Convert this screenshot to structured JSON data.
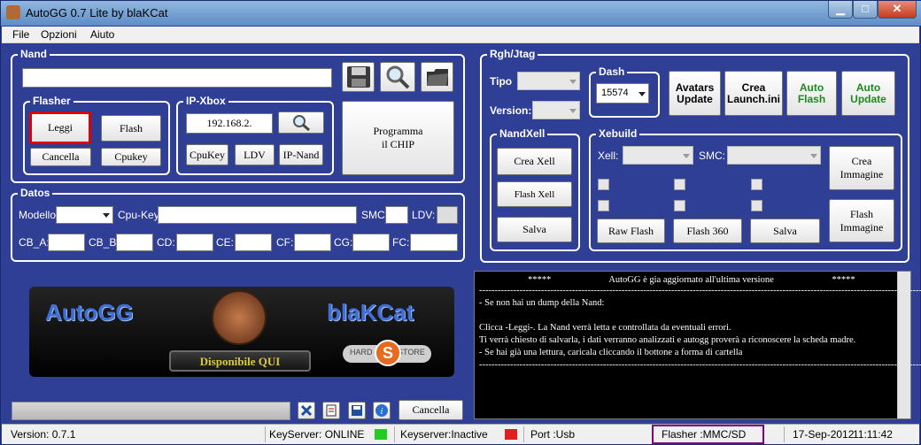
{
  "window": {
    "title": "AutoGG 0.7 Lite by blaKCat"
  },
  "menu": [
    "File",
    "Opzioni",
    "Aiuto"
  ],
  "nand": {
    "title": "Nand",
    "path_value": "",
    "icons": [
      "save-icon",
      "search-icon",
      "folder-icon"
    ]
  },
  "flasher": {
    "title": "Flasher",
    "leggi": "Leggi",
    "flash": "Flash",
    "cancella": "Cancella",
    "cpukey": "Cpukey"
  },
  "ipxbox": {
    "title": "IP-Xbox",
    "ip_value": "192.168.2.",
    "cpukey": "CpuKey",
    "ldv": "LDV",
    "ipnand": "IP-Nand"
  },
  "programma": {
    "label_1": "Programma",
    "label_2": "il CHIP"
  },
  "datos": {
    "title": "Datos",
    "modello": "Modello:",
    "cpukey": "Cpu-Key:",
    "smc": "SMC:",
    "ldv": "LDV:",
    "fields": [
      "CB_A:",
      "CB_B:",
      "CD:",
      "CE:",
      "CF:",
      "CG:",
      "FC:"
    ]
  },
  "rgh": {
    "title": "Rgh/Jtag",
    "tipo": "Tipo",
    "version": "Version:",
    "dash_title": "Dash",
    "dash_value": "15574",
    "avatars": [
      "Avatars",
      "Update"
    ],
    "crea_launch": [
      "Crea",
      "Launch.ini"
    ],
    "auto_flash": [
      "Auto",
      "Flash"
    ],
    "auto_update": [
      "Auto",
      "Update"
    ]
  },
  "nandxell": {
    "title": "NandXell",
    "crea": "Crea Xell",
    "flash": "Flash Xell",
    "salva": "Salva"
  },
  "xebuild": {
    "title": "Xebuild",
    "xell": "Xell:",
    "smc": "SMC:",
    "raw_flash": "Raw Flash",
    "flash360": "Flash 360",
    "salva": "Salva",
    "crea_img": [
      "Crea",
      "Immagine"
    ],
    "flash_img": [
      "Flash",
      "Immagine"
    ]
  },
  "log": {
    "lines": [
      "*****                         AutoGG è gia aggiornato all'ultima versione                         *****",
      "------------------------------------------------------------------------------------------------------------------------------------------------",
      "- Se non hai un dump della Nand:",
      "",
      "Clicca -Leggi-. La Nand verrà letta e controllata da eventuali errori.",
      "Ti verrà chiesto di salvarla, i dati verranno analizzati e autogg proverà a riconoscere la scheda madre.",
      "- Se hai già una lettura, caricala cliccando il bottone a forma di cartella",
      "------------------------------------------------------------------------------------------------------------------------------------------------"
    ]
  },
  "banner": {
    "left": "AutoGG",
    "right": "blaKCat",
    "sub": "Disponibile QUI",
    "store_top": "HARD",
    "store_bottom": "STORE",
    "store_mark": "S"
  },
  "bottom": {
    "cancella": "Cancella",
    "progress": 0
  },
  "status": {
    "version": "Version: 0.7.1",
    "keyserver": "KeyServer: ONLINE",
    "keyserver_inactive": "Keyserver:Inactive",
    "port": "Port :Usb",
    "flasher": "Flasher :MMC/SD",
    "date": "17-Sep-2012",
    "time": "11:11:42"
  },
  "colors": {
    "bg": "#2f3f95",
    "online": "#22cc22",
    "inactive": "#e02020",
    "leggi_border": "#e00000",
    "flasher_border": "#800080"
  }
}
